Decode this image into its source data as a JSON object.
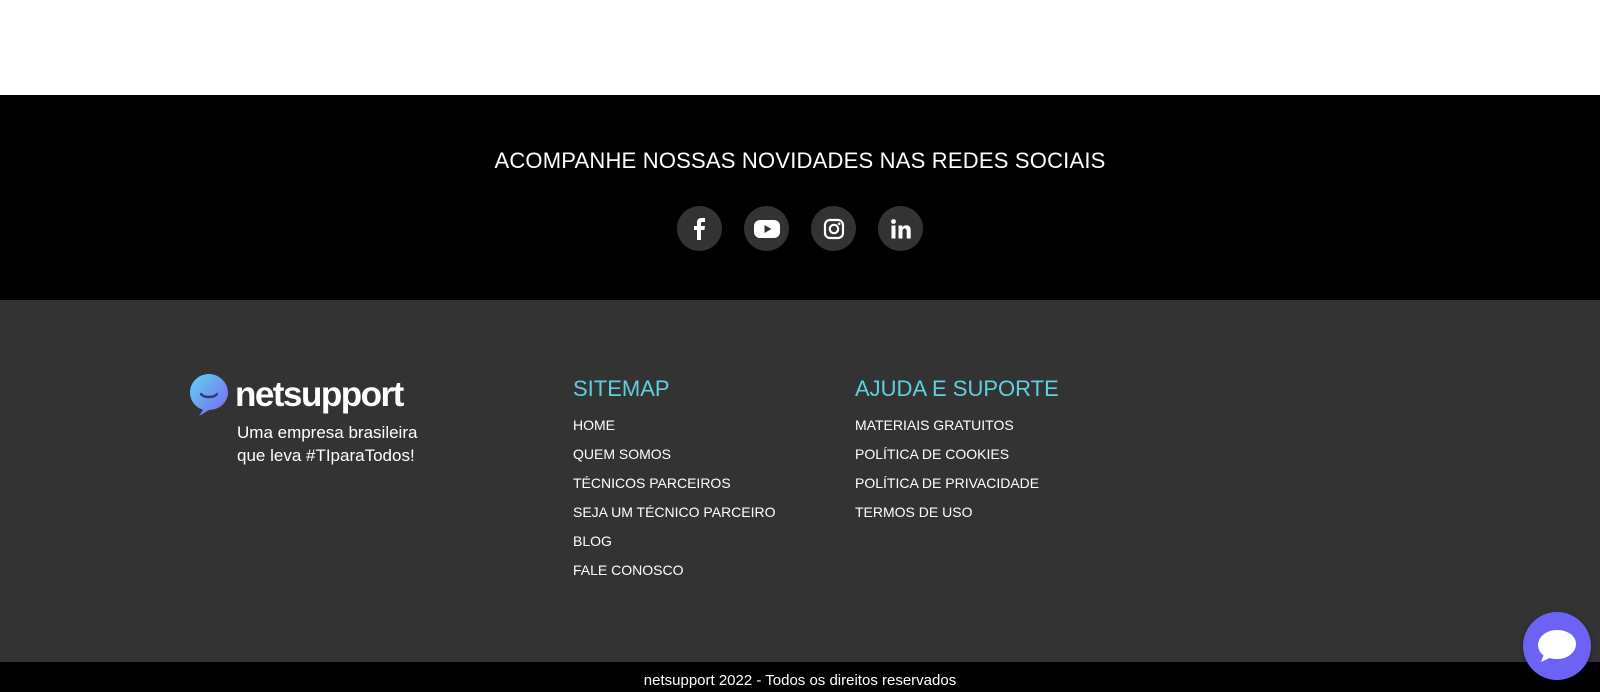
{
  "social": {
    "title": "ACOMPANHE NOSSAS NOVIDADES NAS REDES SOCIAIS",
    "links": [
      {
        "icon": "facebook-icon"
      },
      {
        "icon": "youtube-icon"
      },
      {
        "icon": "instagram-icon"
      },
      {
        "icon": "linkedin-icon"
      }
    ]
  },
  "brand": {
    "name": "netsupport",
    "tagline_line1": "Uma empresa brasileira",
    "tagline_line2": "que leva #TIparaTodos!"
  },
  "sitemap": {
    "title": "SITEMAP",
    "items": [
      {
        "label": "HOME"
      },
      {
        "label": "QUEM SOMOS"
      },
      {
        "label": "TÉCNICOS PARCEIROS"
      },
      {
        "label": "SEJA UM TÉCNICO PARCEIRO"
      },
      {
        "label": "BLOG"
      },
      {
        "label": "FALE CONOSCO"
      }
    ]
  },
  "help": {
    "title": "AJUDA E SUPORTE",
    "items": [
      {
        "label": "MATERIAIS GRATUITOS"
      },
      {
        "label": "POLÍTICA DE COOKIES"
      },
      {
        "label": "POLÍTICA DE PRIVACIDADE"
      },
      {
        "label": "TERMOS DE USO"
      }
    ]
  },
  "footer": {
    "copyright": "netsupport 2022 - Todos os direitos reservados"
  },
  "chat": {
    "icon": "chat-bubble-icon"
  },
  "colors": {
    "social_band_bg": "#000000",
    "footer_bg": "#333333",
    "accent": "#5ed0e0",
    "social_btn_bg": "#333333",
    "chat_btn": "#6c63f5"
  }
}
